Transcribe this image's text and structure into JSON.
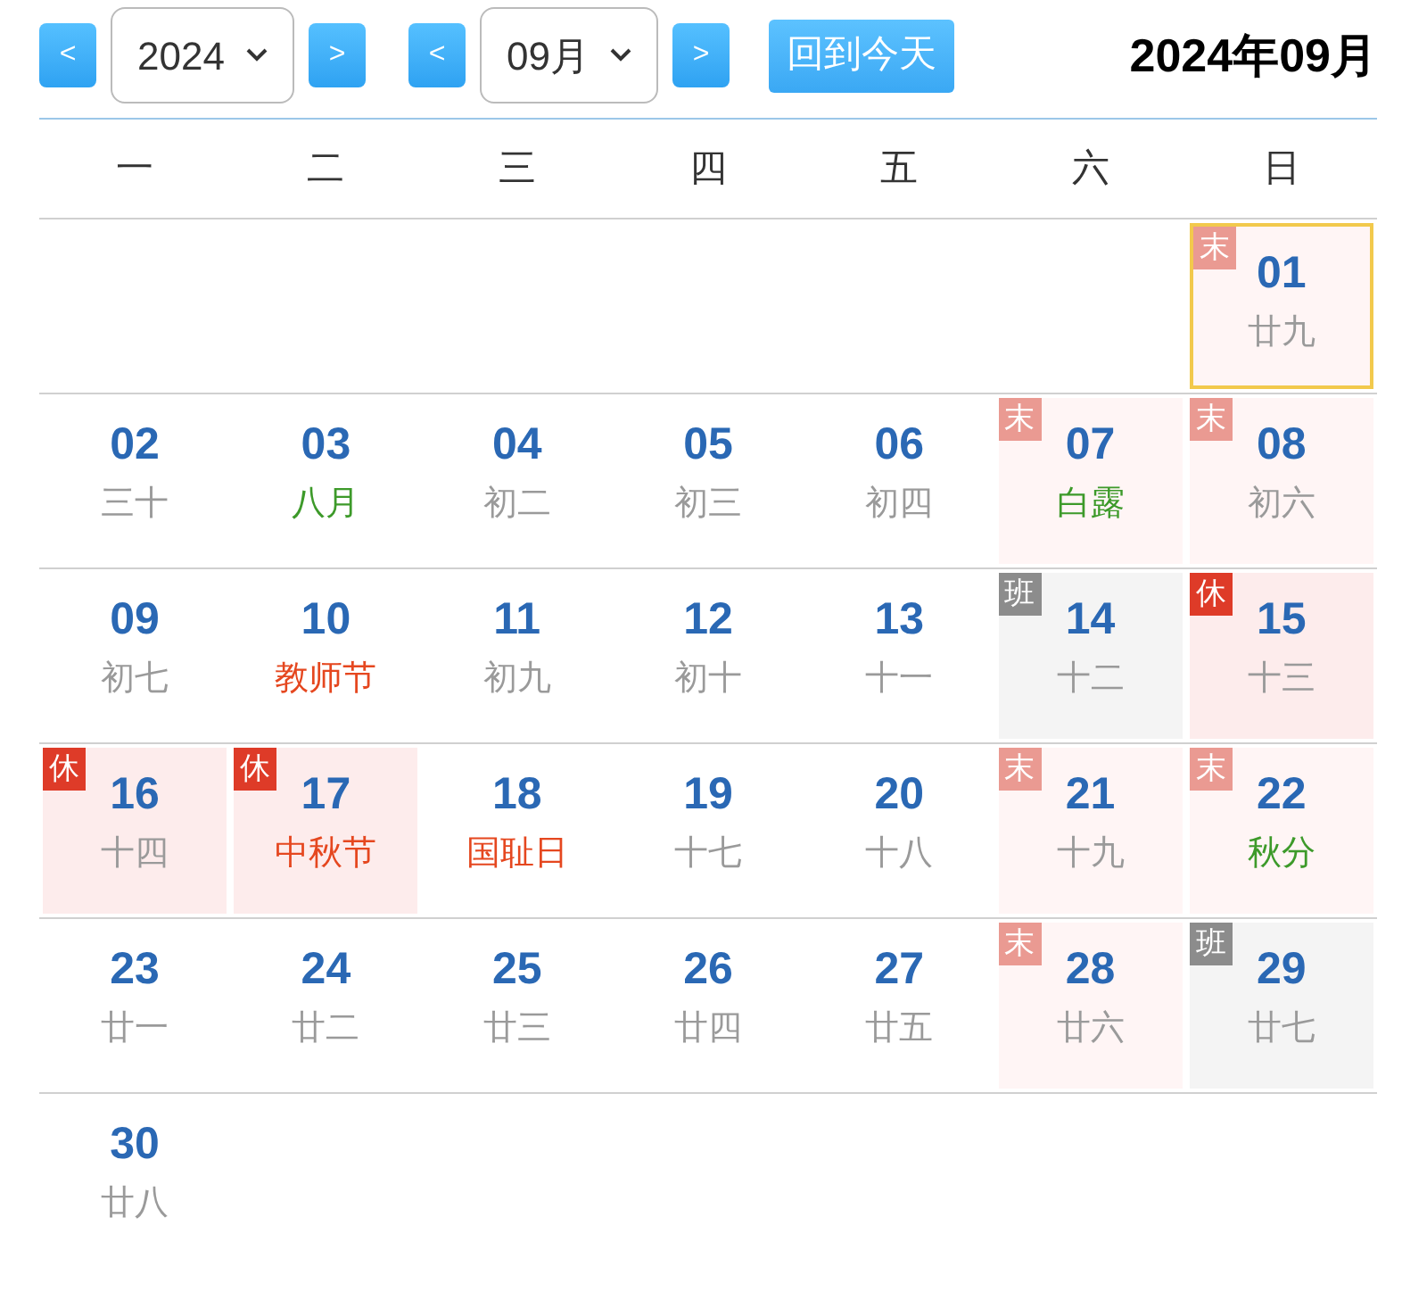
{
  "toolbar": {
    "year_prev": "<",
    "year": "2024",
    "year_next": ">",
    "month_prev": "<",
    "month": "09月",
    "month_next": ">",
    "today_button": "回到今天",
    "title": "2024年09月"
  },
  "weekdays": [
    "一",
    "二",
    "三",
    "四",
    "五",
    "六",
    "日"
  ],
  "weeks": [
    [
      {
        "kind": "blank"
      },
      {
        "kind": "blank"
      },
      {
        "kind": "blank"
      },
      {
        "kind": "blank"
      },
      {
        "kind": "blank"
      },
      {
        "kind": "blank"
      },
      {
        "kind": "weekend",
        "badge": "末",
        "day": "01",
        "lunar": {
          "text": "廿九",
          "kind": "lunar"
        },
        "selected": true
      }
    ],
    [
      {
        "kind": "normal",
        "day": "02",
        "lunar": {
          "text": "三十",
          "kind": "lunar"
        },
        "selected": false
      },
      {
        "kind": "normal",
        "day": "03",
        "lunar": {
          "text": "八月",
          "kind": "term"
        },
        "selected": false
      },
      {
        "kind": "normal",
        "day": "04",
        "lunar": {
          "text": "初二",
          "kind": "lunar"
        },
        "selected": false
      },
      {
        "kind": "normal",
        "day": "05",
        "lunar": {
          "text": "初三",
          "kind": "lunar"
        },
        "selected": false
      },
      {
        "kind": "normal",
        "day": "06",
        "lunar": {
          "text": "初四",
          "kind": "lunar"
        },
        "selected": false
      },
      {
        "kind": "weekend",
        "badge": "末",
        "day": "07",
        "lunar": {
          "text": "白露",
          "kind": "term"
        },
        "selected": false
      },
      {
        "kind": "weekend",
        "badge": "末",
        "day": "08",
        "lunar": {
          "text": "初六",
          "kind": "lunar"
        },
        "selected": false
      }
    ],
    [
      {
        "kind": "normal",
        "day": "09",
        "lunar": {
          "text": "初七",
          "kind": "lunar"
        },
        "selected": false
      },
      {
        "kind": "normal",
        "day": "10",
        "lunar": {
          "text": "教师节",
          "kind": "festival"
        },
        "selected": false
      },
      {
        "kind": "normal",
        "day": "11",
        "lunar": {
          "text": "初九",
          "kind": "lunar"
        },
        "selected": false
      },
      {
        "kind": "normal",
        "day": "12",
        "lunar": {
          "text": "初十",
          "kind": "lunar"
        },
        "selected": false
      },
      {
        "kind": "normal",
        "day": "13",
        "lunar": {
          "text": "十一",
          "kind": "lunar"
        },
        "selected": false
      },
      {
        "kind": "workday",
        "badge": "班",
        "day": "14",
        "lunar": {
          "text": "十二",
          "kind": "lunar"
        },
        "selected": false
      },
      {
        "kind": "holiday",
        "badge": "休",
        "day": "15",
        "lunar": {
          "text": "十三",
          "kind": "lunar"
        },
        "selected": false
      }
    ],
    [
      {
        "kind": "holiday",
        "badge": "休",
        "day": "16",
        "lunar": {
          "text": "十四",
          "kind": "lunar"
        },
        "selected": false
      },
      {
        "kind": "holiday",
        "badge": "休",
        "day": "17",
        "lunar": {
          "text": "中秋节",
          "kind": "festival"
        },
        "selected": false
      },
      {
        "kind": "normal",
        "day": "18",
        "lunar": {
          "text": "国耻日",
          "kind": "festival"
        },
        "selected": false
      },
      {
        "kind": "normal",
        "day": "19",
        "lunar": {
          "text": "十七",
          "kind": "lunar"
        },
        "selected": false
      },
      {
        "kind": "normal",
        "day": "20",
        "lunar": {
          "text": "十八",
          "kind": "lunar"
        },
        "selected": false
      },
      {
        "kind": "weekend",
        "badge": "末",
        "day": "21",
        "lunar": {
          "text": "十九",
          "kind": "lunar"
        },
        "selected": false
      },
      {
        "kind": "weekend",
        "badge": "末",
        "day": "22",
        "lunar": {
          "text": "秋分",
          "kind": "term"
        },
        "selected": false
      }
    ],
    [
      {
        "kind": "normal",
        "day": "23",
        "lunar": {
          "text": "廿一",
          "kind": "lunar"
        },
        "selected": false
      },
      {
        "kind": "normal",
        "day": "24",
        "lunar": {
          "text": "廿二",
          "kind": "lunar"
        },
        "selected": false
      },
      {
        "kind": "normal",
        "day": "25",
        "lunar": {
          "text": "廿三",
          "kind": "lunar"
        },
        "selected": false
      },
      {
        "kind": "normal",
        "day": "26",
        "lunar": {
          "text": "廿四",
          "kind": "lunar"
        },
        "selected": false
      },
      {
        "kind": "normal",
        "day": "27",
        "lunar": {
          "text": "廿五",
          "kind": "lunar"
        },
        "selected": false
      },
      {
        "kind": "weekend",
        "badge": "末",
        "day": "28",
        "lunar": {
          "text": "廿六",
          "kind": "lunar"
        },
        "selected": false
      },
      {
        "kind": "workday",
        "badge": "班",
        "day": "29",
        "lunar": {
          "text": "廿七",
          "kind": "lunar"
        },
        "selected": false
      }
    ],
    [
      {
        "kind": "normal",
        "day": "30",
        "lunar": {
          "text": "廿八",
          "kind": "lunar"
        },
        "selected": false
      },
      {
        "kind": "blank"
      },
      {
        "kind": "blank"
      },
      {
        "kind": "blank"
      },
      {
        "kind": "blank"
      },
      {
        "kind": "blank"
      },
      {
        "kind": "blank"
      }
    ]
  ]
}
